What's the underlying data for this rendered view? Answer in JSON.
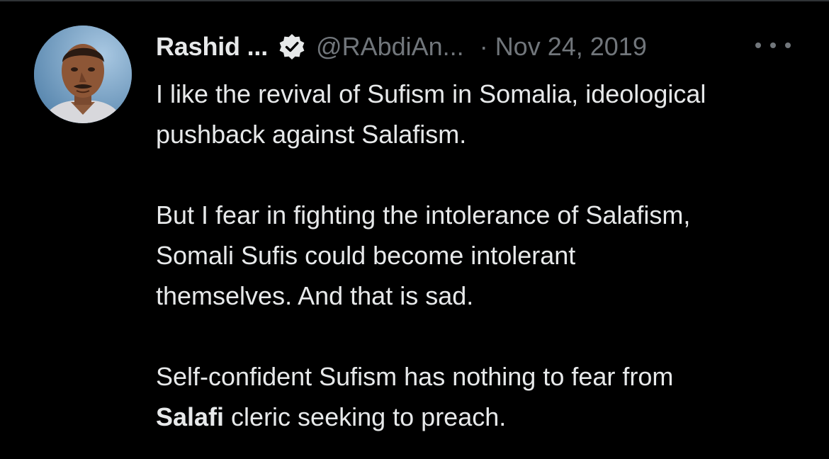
{
  "tweet": {
    "display_name": "Rashid ...",
    "handle": "@RAbdiAn...",
    "separator": "·",
    "date": "Nov 24, 2019",
    "avatar_icon": "user-avatar",
    "verified_icon": "verified-badge-icon",
    "more_icon": "more-options-icon",
    "body": {
      "p1_l1": "I like the revival of Sufism in Somalia, ideological",
      "p1_l2": "pushback against Salafism.",
      "p2_l1": "But I fear in fighting the intolerance of Salafism,",
      "p2_l2": "Somali Sufis could become intolerant",
      "p2_l3": "themselves. And that is sad.",
      "p3_l1": "Self-confident Sufism has nothing to fear from",
      "p3_l2_bold": "Salafi",
      "p3_l2_rest": " cleric seeking to preach."
    }
  },
  "colors": {
    "background": "#000000",
    "text_primary": "#e7e9ea",
    "text_secondary": "#71767b",
    "border": "#2f3336"
  }
}
